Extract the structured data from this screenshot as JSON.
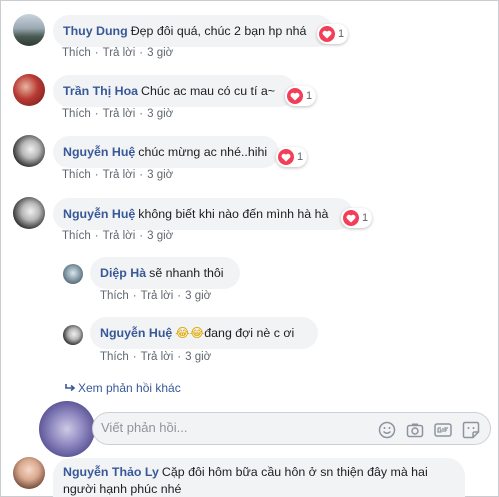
{
  "comments": [
    {
      "name": "Thuy Dung",
      "text": "Đẹp đôi quá, chúc 2 bạn hp nhá",
      "reactions": "1"
    },
    {
      "name": "Trần Thị Hoa",
      "text": "Chúc ac mau có cu tí a~",
      "reactions": "1"
    },
    {
      "name": "Nguyễn Huệ",
      "text": "chúc mừng ac nhé..hihi",
      "reactions": "1"
    },
    {
      "name": "Nguyễn Huệ",
      "text": "không biết khi nào đến mình hà hà",
      "reactions": "1"
    }
  ],
  "replies": [
    {
      "name": "Diệp Hà",
      "text": "sẽ nhanh thôi"
    },
    {
      "name": "Nguyễn Huệ",
      "emoji": "😂😂",
      "text": "đang đợi nè c ơi"
    }
  ],
  "actions": {
    "like": "Thích",
    "reply": "Trả lời",
    "time": "3 giờ",
    "sep": "·"
  },
  "more_replies": "Xem phản hồi khác",
  "reply_input": {
    "placeholder": "Viết phản hồi..."
  },
  "last_comment": {
    "name": "Nguyễn Thảo Ly",
    "line1": "Cặp đôi hôm bữa cầu hôn ở sn thiện đây mà hai",
    "line2": "người hạnh phúc nhé"
  },
  "icons": [
    "heart-icon",
    "reply-arrow-icon",
    "emoji-icon",
    "camera-icon",
    "gif-icon",
    "sticker-icon"
  ],
  "colors": {
    "name": "#385898",
    "bubble": "#f2f3f5",
    "heart": "#f33e58",
    "meta": "#606770"
  }
}
